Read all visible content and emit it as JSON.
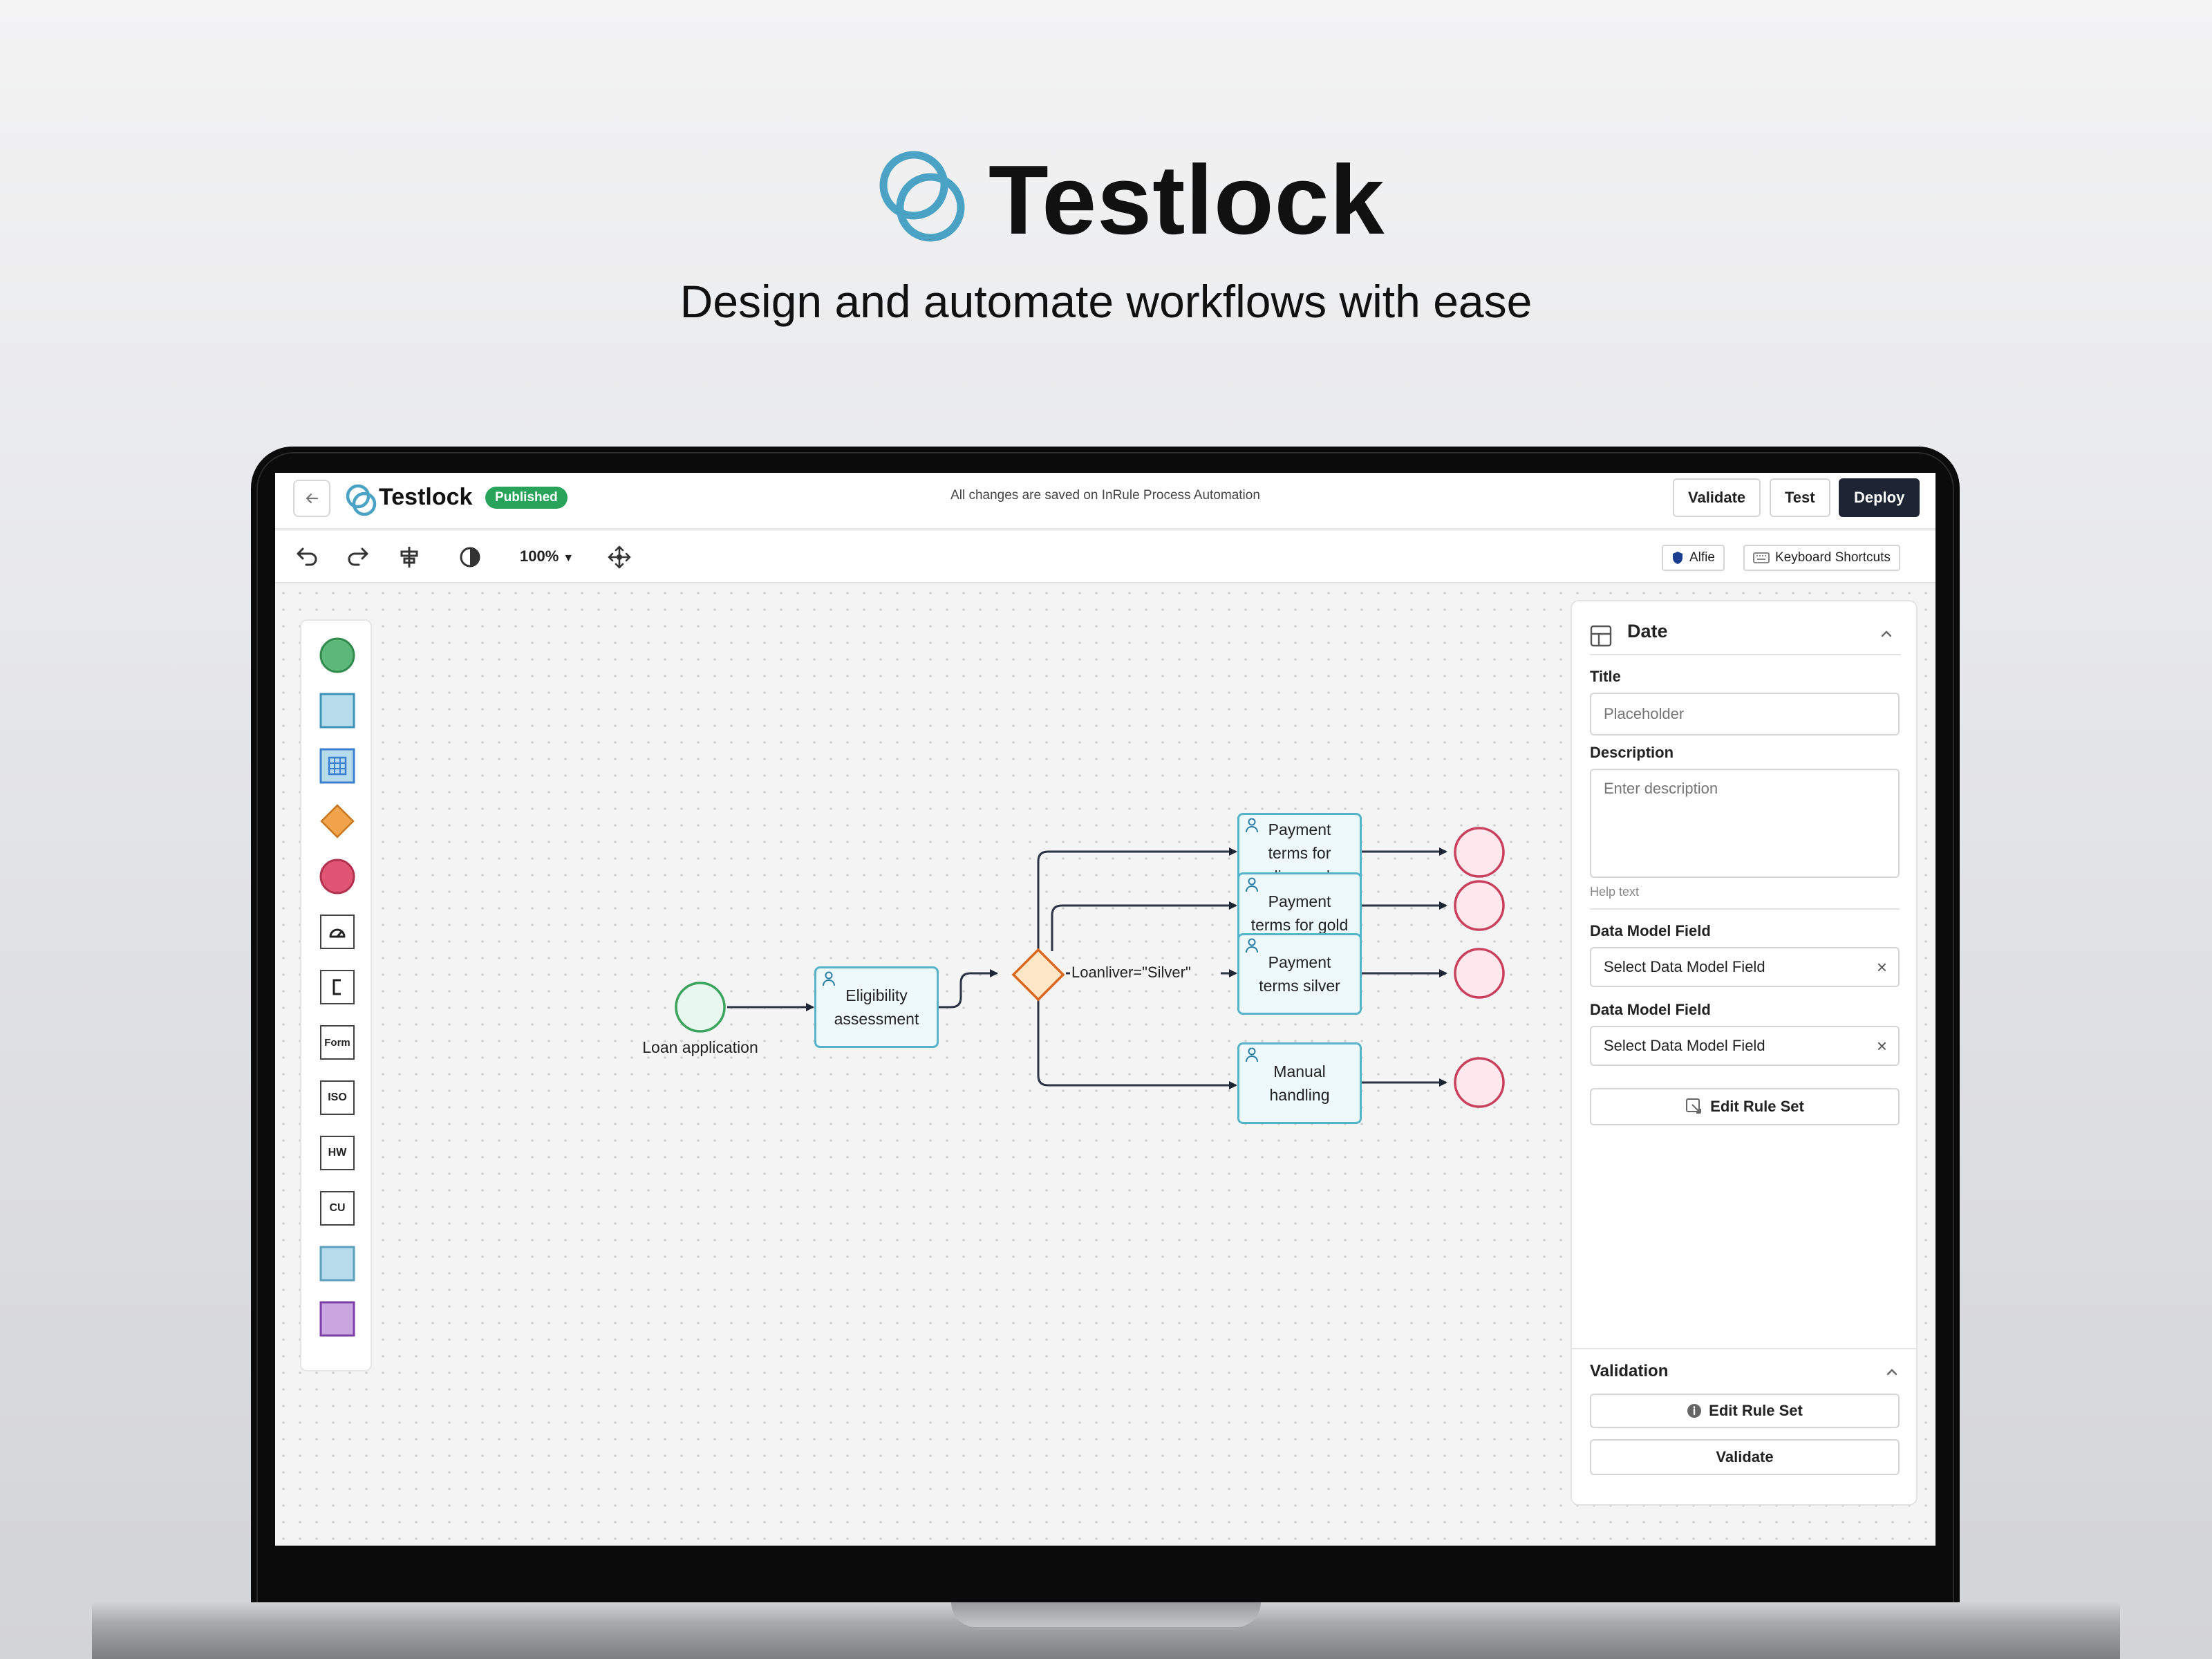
{
  "hero": {
    "title": "Testlock",
    "subtitle": "Design and automate workflows with ease"
  },
  "header": {
    "app_name": "Testlock",
    "status_badge": "Published",
    "save_status": "All changes are saved on InRule Process Automation",
    "buttons": {
      "validate": "Validate",
      "test": "Test",
      "deploy": "Deploy"
    }
  },
  "toolbar": {
    "zoom": "100%",
    "alfie": "Alfie",
    "shortcuts": "Keyboard Shortcuts"
  },
  "palette": {
    "form": "Form",
    "iso": "ISO",
    "hw": "HW",
    "cu": "CU"
  },
  "diagram": {
    "start_label": "Loan application",
    "task_eligibility": "Eligibility assessment",
    "task_diamond": "Payment terms for diamond",
    "task_gold": "Payment terms for gold",
    "task_silver": "Payment terms silver",
    "task_manual": "Manual handling",
    "condition_label": "Loanliver=\"Silver\""
  },
  "properties": {
    "section_title": "Date",
    "title_label": "Title",
    "title_placeholder": "Placeholder",
    "description_label": "Description",
    "description_placeholder": "Enter description",
    "help_text": "Help text",
    "data_model_label_1": "Data Model Field",
    "data_model_value_1": "Select Data Model Field",
    "data_model_label_2": "Data Model Field",
    "data_model_value_2": "Select Data Model Field",
    "edit_rule_set": "Edit Rule Set",
    "validation_title": "Validation",
    "validation_edit_rule_set": "Edit Rule Set",
    "validation_validate": "Validate"
  },
  "colors": {
    "brand_blue": "#4aa3c4",
    "published_green": "#27a35a",
    "deploy_dark": "#1d2433",
    "task_border": "#57b3c9",
    "start_green": "#3aa35c",
    "end_red": "#c9405e",
    "gateway_orange": "#e08a2a"
  }
}
